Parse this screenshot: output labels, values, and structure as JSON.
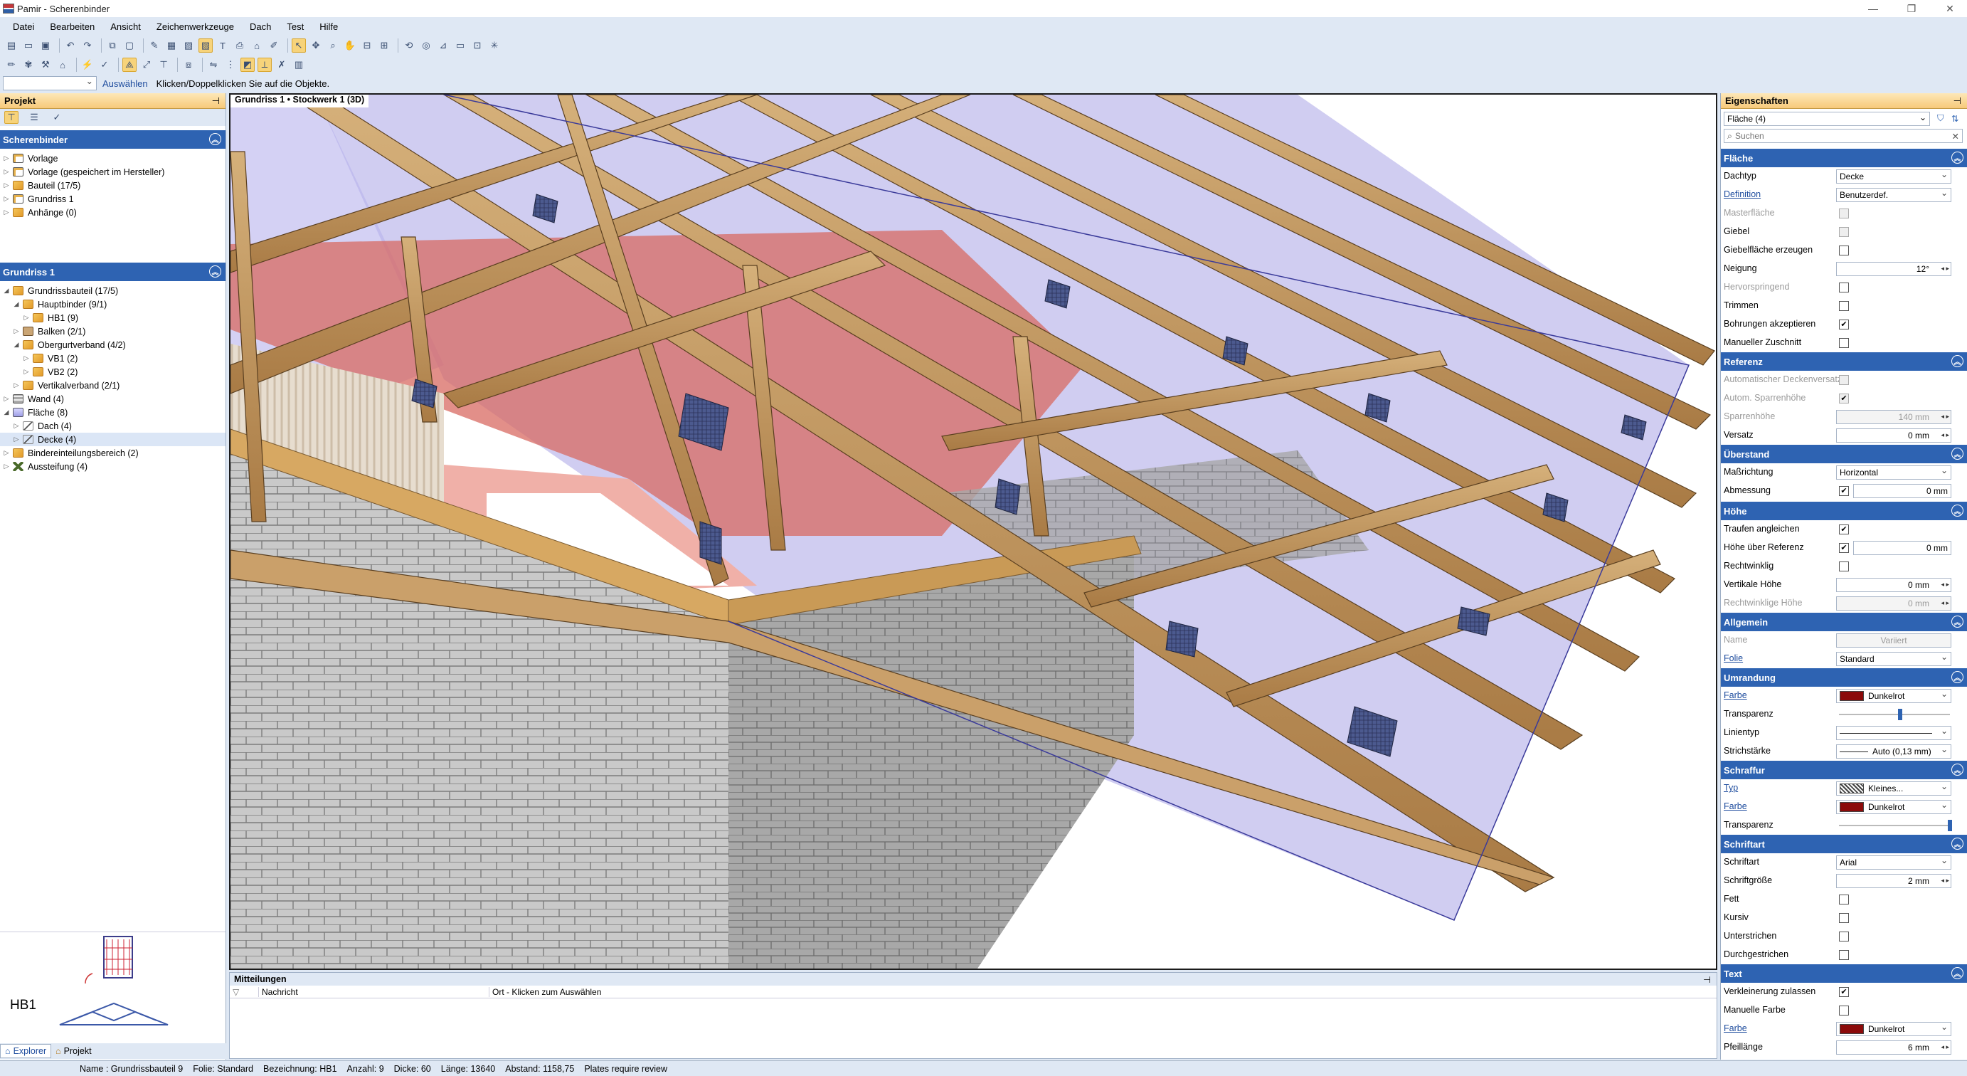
{
  "window": {
    "title": "Pamir - Scherenbinder",
    "min_icon": "minimize-icon",
    "max_icon": "maximize-icon",
    "close_icon": "close-icon"
  },
  "menu": [
    "Datei",
    "Bearbeiten",
    "Ansicht",
    "Zeichenwerkzeuge",
    "Dach",
    "Test",
    "Hilfe"
  ],
  "command": {
    "keyword": "Auswählen",
    "hint": "Klicken/Doppelklicken Sie auf die Objekte."
  },
  "project_panel": {
    "title": "Projekt",
    "section": "Scherenbinder",
    "items": [
      "Vorlage",
      "Vorlage (gespeichert im Hersteller)",
      "Bauteil (17/5)",
      "Grundriss 1",
      "Anhänge (0)"
    ]
  },
  "tree_panel": {
    "section": "Grundriss 1",
    "items": [
      "Grundrissbauteil (17/5)",
      "Hauptbinder (9/1)",
      "HB1 (9)",
      "Balken (2/1)",
      "Obergurtverband (4/2)",
      "VB1 (2)",
      "VB2 (2)",
      "Vertikalverband (2/1)",
      "Wand (4)",
      "Fläche (8)",
      "Dach (4)",
      "Decke (4)",
      "Bindereinteilungsbereich (2)",
      "Aussteifung (4)"
    ]
  },
  "preview": {
    "label": "HB1"
  },
  "tabs": [
    "Explorer",
    "Projekt"
  ],
  "view": {
    "title": "Grundriss 1 • Stockwerk 1 (3D)"
  },
  "messages": {
    "title": "Mitteilungen",
    "col_message": "Nachricht",
    "col_location": "Ort - Klicken zum Auswählen"
  },
  "props": {
    "title": "Eigenschaften",
    "selector": "Fläche (4)",
    "search_placeholder": "Suchen",
    "sec_flaeche": "Fläche",
    "dachtyp_l": "Dachtyp",
    "dachtyp_v": "Decke",
    "definition_l": "Definition",
    "definition_v": "Benutzerdef.",
    "masterflaeche_l": "Masterfläche",
    "giebel_l": "Giebel",
    "giebelflaeche_l": "Giebelfläche erzeugen",
    "neigung_l": "Neigung",
    "neigung_v": "12°",
    "hervor_l": "Hervorspringend",
    "trimmen_l": "Trimmen",
    "bohr_l": "Bohrungen akzeptieren",
    "manuell_l": "Manueller Zuschnitt",
    "sec_referenz": "Referenz",
    "autodecke_l": "Automatischer Deckenversatz",
    "autosparren_l": "Autom. Sparrenhöhe",
    "sparren_l": "Sparrenhöhe",
    "sparren_v": "140 mm",
    "versatz_l": "Versatz",
    "versatz_v": "0 mm",
    "sec_ueberstand": "Überstand",
    "massr_l": "Maßrichtung",
    "massr_v": "Horizontal",
    "abm_l": "Abmessung",
    "abm_v": "0 mm",
    "sec_hoehe": "Höhe",
    "trauf_l": "Traufen angleichen",
    "hoeheref_l": "Höhe über Referenz",
    "hoeheref_v": "0 mm",
    "recht_l": "Rechtwinklig",
    "verth_l": "Vertikale Höhe",
    "verth_v": "0 mm",
    "rechth_l": "Rechtwinklige Höhe",
    "rechth_v": "0 mm",
    "sec_allgemein": "Allgemein",
    "name_l": "Name",
    "name_v": "Variiert",
    "folie_l": "Folie",
    "folie_v": "Standard",
    "sec_umrandung": "Umrandung",
    "farbe_l": "Farbe",
    "farbe_v": "Dunkelrot",
    "transp_l": "Transparenz",
    "linientyp_l": "Linientyp",
    "strich_l": "Strichstärke",
    "strich_v": "Auto (0,13 mm)",
    "sec_schraffur": "Schraffur",
    "typ_l": "Typ",
    "typ_v": "Kleines...",
    "sfarbe_l": "Farbe",
    "sfarbe_v": "Dunkelrot",
    "stransp_l": "Transparenz",
    "sec_schriftart": "Schriftart",
    "schriftart_l": "Schriftart",
    "schriftart_v": "Arial",
    "groesse_l": "Schriftgröße",
    "groesse_v": "2 mm",
    "fett_l": "Fett",
    "kursiv_l": "Kursiv",
    "unter_l": "Unterstrichen",
    "durch_l": "Durchgestrichen",
    "sec_text": "Text",
    "verkl_l": "Verkleinerung zulassen",
    "manfarbe_l": "Manuelle Farbe",
    "tfarbe_l": "Farbe",
    "tfarbe_v": "Dunkelrot",
    "pfeil_l": "Pfeillänge",
    "pfeil_v": "6 mm",
    "dark_red": "#8b0a0a",
    "umrandung_transparency_pct": 55,
    "schraffur_transparency_pct": 100
  },
  "status": {
    "name": "Name : Grundrissbauteil 9",
    "folie": "Folie: Standard",
    "bez": "Bezeichnung: HB1",
    "anzahl": "Anzahl: 9",
    "dicke": "Dicke: 60",
    "laenge": "Länge: 13640",
    "abstand": "Abstand: 1158,75",
    "note": "Plates require review"
  },
  "colors": {
    "accent": "#2e63b2",
    "panel_header": "#f7c97a",
    "selection": "#f7d37a"
  }
}
